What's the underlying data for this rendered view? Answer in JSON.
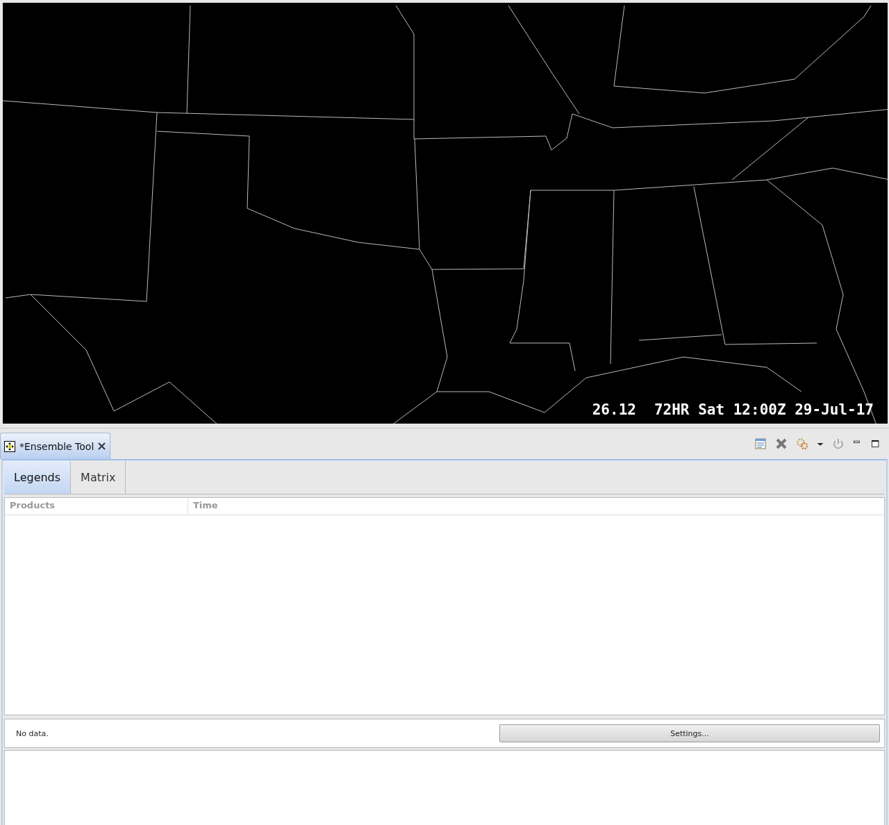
{
  "map": {
    "readout": "26.12",
    "valid_time": "72HR Sat 12:00Z 29-Jul-17"
  },
  "view": {
    "title": "*Ensemble Tool"
  },
  "tabs": [
    {
      "label": "Legends",
      "selected": true
    },
    {
      "label": "Matrix",
      "selected": false
    }
  ],
  "table": {
    "columns": [
      "Products",
      "Time"
    ]
  },
  "status": {
    "message": "No data.",
    "button": "Settings..."
  }
}
